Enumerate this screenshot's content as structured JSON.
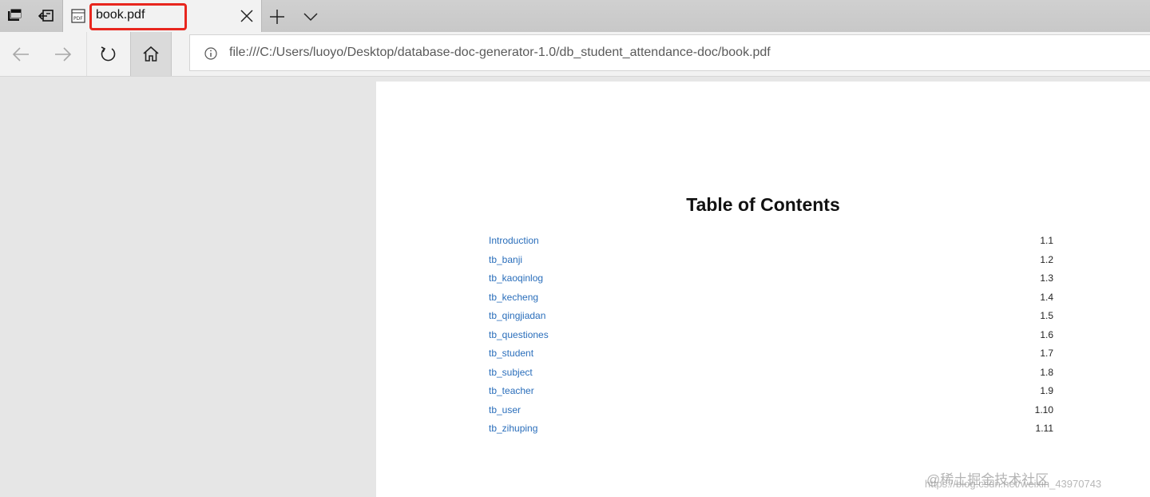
{
  "tabs": {
    "active": {
      "title": "book.pdf",
      "favicon": "pdf-icon"
    },
    "controls": [
      "set-tabs-aside-icon",
      "restore-tabs-icon",
      "new-tab-icon",
      "tab-list-icon"
    ]
  },
  "nav": {
    "buttons": [
      "back-icon",
      "forward-icon",
      "refresh-icon",
      "home-icon"
    ],
    "url": "file:///C:/Users/luoyo/Desktop/database-doc-generator-1.0/db_student_attendance-doc/book.pdf"
  },
  "document": {
    "title": "Table of Contents",
    "entries": [
      {
        "label": "Introduction",
        "number": "1.1"
      },
      {
        "label": "tb_banji",
        "number": "1.2"
      },
      {
        "label": "tb_kaoqinlog",
        "number": "1.3"
      },
      {
        "label": "tb_kecheng",
        "number": "1.4"
      },
      {
        "label": "tb_qingjiadan",
        "number": "1.5"
      },
      {
        "label": "tb_questiones",
        "number": "1.6"
      },
      {
        "label": "tb_student",
        "number": "1.7"
      },
      {
        "label": "tb_subject",
        "number": "1.8"
      },
      {
        "label": "tb_teacher",
        "number": "1.9"
      },
      {
        "label": "tb_user",
        "number": "1.10"
      },
      {
        "label": "tb_zihuping",
        "number": "1.11"
      }
    ]
  },
  "watermark": {
    "text": "@稀土掘金技术社区",
    "url": "https://blog.csdn.net/weixin_43970743"
  },
  "colors": {
    "link": "#2a6ebb",
    "highlight": "#e8261e"
  }
}
